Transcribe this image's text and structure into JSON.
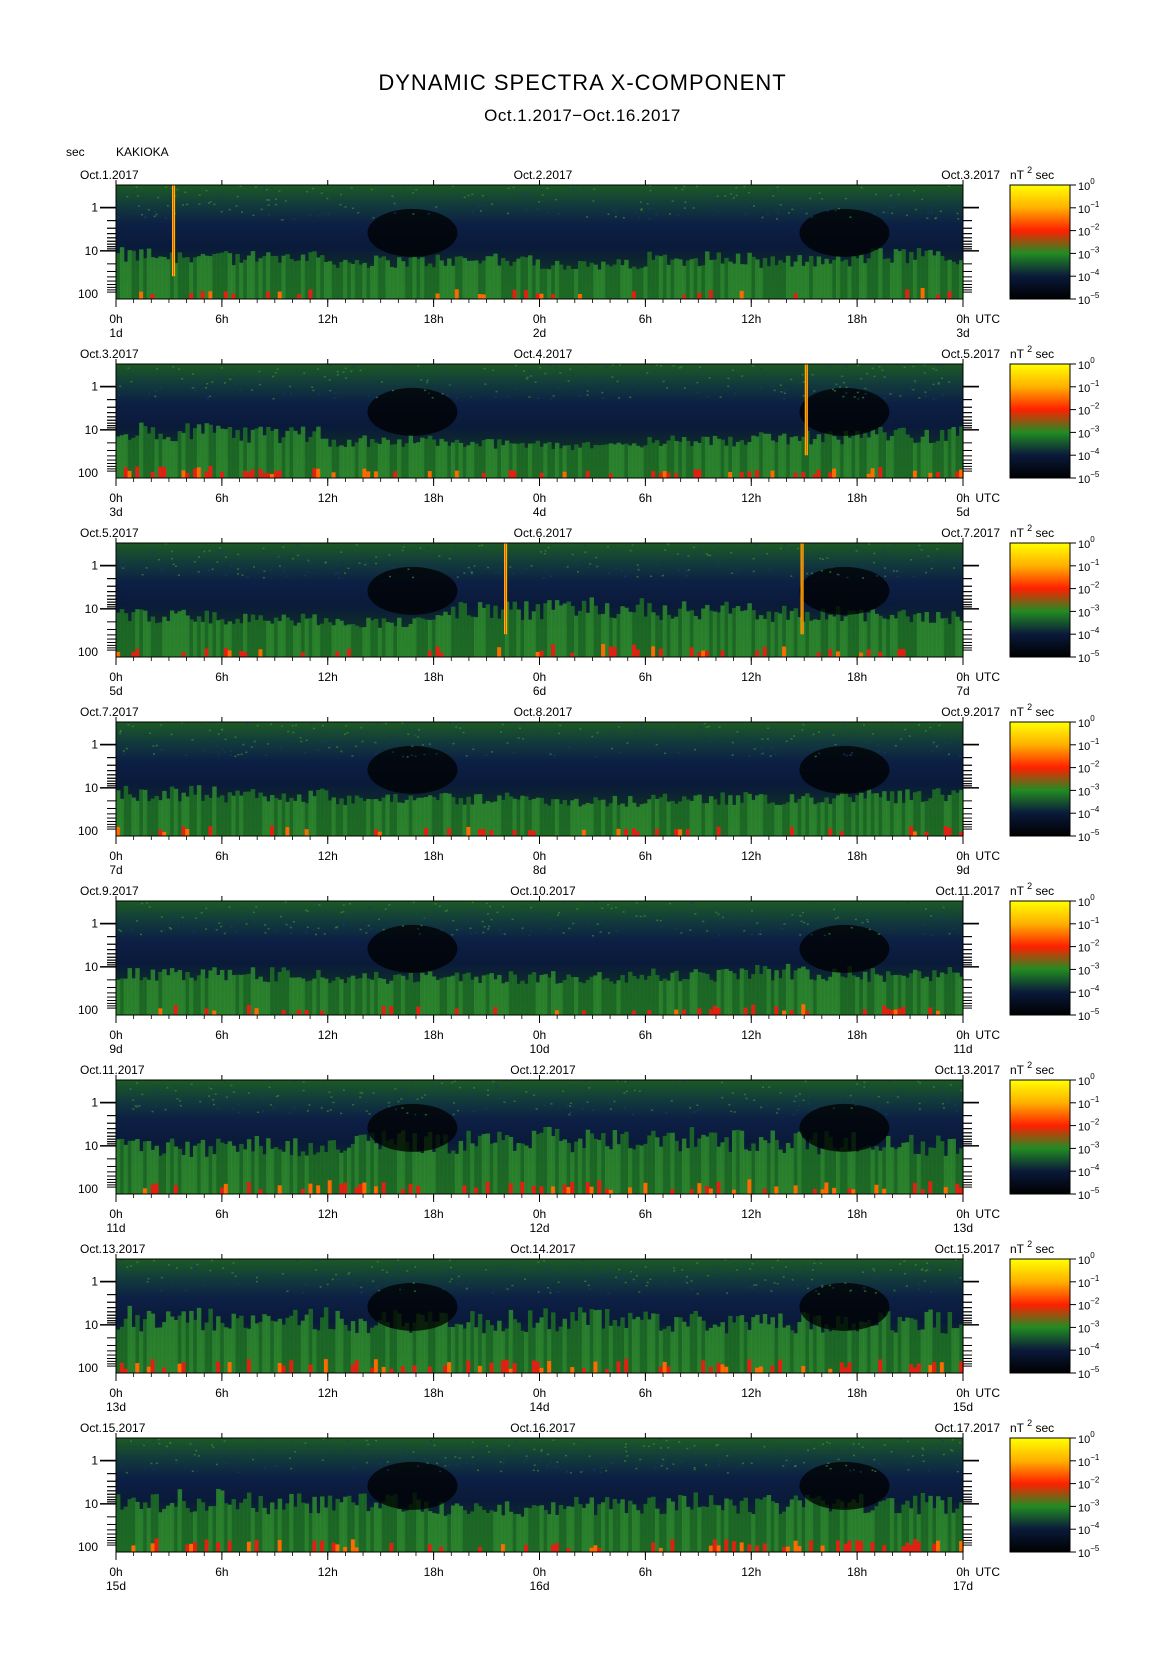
{
  "header": {
    "title": "DYNAMIC SPECTRA X-COMPONENT",
    "subtitle": "Oct.1.2017−Oct.16.2017",
    "y_unit": "sec",
    "station": "KAKIOKA"
  },
  "colorbar": {
    "unit": "nT",
    "unit_exp": "2",
    "unit_suffix": "sec",
    "tick_labels": [
      "10",
      "10",
      "10",
      "10",
      "10",
      "10"
    ],
    "tick_exponents": [
      "0",
      "−1",
      "−2",
      "−3",
      "−4",
      "−5"
    ],
    "colors": [
      "#ffff00",
      "#ffb000",
      "#ff2000",
      "#228b22",
      "#0a1a3a",
      "#000000"
    ]
  },
  "chart_data": {
    "type": "heatmap",
    "y_axis": {
      "label": "sec",
      "scale": "log",
      "tick_labels": [
        "1",
        "10",
        "100"
      ],
      "range": [
        0.3,
        130
      ]
    },
    "x_axis": {
      "tick_labels": [
        "0h",
        "6h",
        "12h",
        "18h",
        "0h",
        "6h",
        "12h",
        "18h",
        "0h"
      ],
      "utc_label": "UTC"
    },
    "panels": [
      {
        "left_date": "Oct.1.2017",
        "mid_date": "Oct.2.2017",
        "right_date": "Oct.3.2017",
        "day_labels": [
          "1d",
          "2d",
          "3d"
        ],
        "spikes": [
          0.068
        ],
        "disturbance": [
          0.4,
          0.35,
          0.3,
          0.32,
          0.25,
          0.35,
          0.3,
          0.4
        ]
      },
      {
        "left_date": "Oct.3.2017",
        "mid_date": "Oct.4.2017",
        "right_date": "Oct.5.2017",
        "day_labels": [
          "3d",
          "4d",
          "5d"
        ],
        "spikes": [
          0.815
        ],
        "disturbance": [
          0.45,
          0.4,
          0.3,
          0.25,
          0.2,
          0.3,
          0.35,
          0.4
        ]
      },
      {
        "left_date": "Oct.5.2017",
        "mid_date": "Oct.6.2017",
        "right_date": "Oct.7.2017",
        "day_labels": [
          "5d",
          "6d",
          "7d"
        ],
        "spikes": [
          0.46,
          0.81
        ],
        "disturbance": [
          0.35,
          0.3,
          0.25,
          0.45,
          0.5,
          0.45,
          0.4,
          0.35
        ]
      },
      {
        "left_date": "Oct.7.2017",
        "mid_date": "Oct.8.2017",
        "right_date": "Oct.9.2017",
        "day_labels": [
          "7d",
          "8d",
          "9d"
        ],
        "spikes": [],
        "disturbance": [
          0.4,
          0.35,
          0.3,
          0.3,
          0.25,
          0.3,
          0.3,
          0.35
        ]
      },
      {
        "left_date": "Oct.9.2017",
        "mid_date": "Oct.10.2017",
        "right_date": "Oct.11.2017",
        "day_labels": [
          "9d",
          "10d",
          "11d"
        ],
        "spikes": [],
        "disturbance": [
          0.35,
          0.35,
          0.3,
          0.3,
          0.3,
          0.35,
          0.4,
          0.35
        ]
      },
      {
        "left_date": "Oct.11.2017",
        "mid_date": "Oct.12.2017",
        "right_date": "Oct.13.2017",
        "day_labels": [
          "11d",
          "12d",
          "13d"
        ],
        "spikes": [],
        "disturbance": [
          0.45,
          0.5,
          0.55,
          0.55,
          0.6,
          0.6,
          0.55,
          0.5
        ]
      },
      {
        "left_date": "Oct.13.2017",
        "mid_date": "Oct.14.2017",
        "right_date": "Oct.15.2017",
        "day_labels": [
          "13d",
          "14d",
          "15d"
        ],
        "spikes": [],
        "disturbance": [
          0.6,
          0.6,
          0.55,
          0.55,
          0.6,
          0.55,
          0.55,
          0.55
        ]
      },
      {
        "left_date": "Oct.15.2017",
        "mid_date": "Oct.16.2017",
        "right_date": "Oct.17.2017",
        "day_labels": [
          "15d",
          "16d",
          "17d"
        ],
        "spikes": [],
        "disturbance": [
          0.55,
          0.5,
          0.5,
          0.4,
          0.45,
          0.5,
          0.5,
          0.5
        ]
      }
    ]
  }
}
